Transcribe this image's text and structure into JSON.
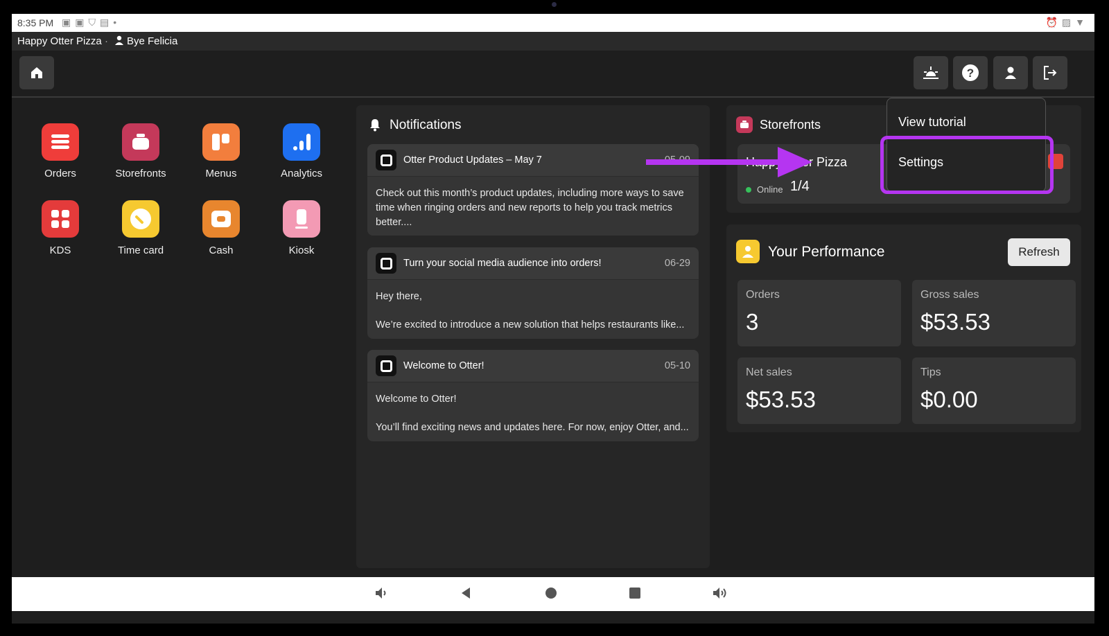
{
  "status": {
    "time": "8:35 PM"
  },
  "header": {
    "store_name": "Happy Otter Pizza",
    "separator": "·",
    "user_name": "Bye Felicia"
  },
  "apps": [
    {
      "label": "Orders",
      "color": "#ef3d3a"
    },
    {
      "label": "Storefronts",
      "color": "#c4395a"
    },
    {
      "label": "Menus",
      "color": "#f27e3d"
    },
    {
      "label": "Analytics",
      "color": "#1e6ff0"
    },
    {
      "label": "KDS",
      "color": "#e43b3b"
    },
    {
      "label": "Time card",
      "color": "#f6c930"
    },
    {
      "label": "Cash",
      "color": "#e8862e"
    },
    {
      "label": "Kiosk",
      "color": "#f39ab4"
    }
  ],
  "notifications": {
    "title": "Notifications",
    "items": [
      {
        "title": "Otter Product Updates – May 7",
        "date": "05-09",
        "body": "Check out this month’s product updates, including more ways to save time when ringing orders and new reports to help you track metrics better...."
      },
      {
        "title": "Turn your social media audience into orders!",
        "date": "06-29",
        "body1": "Hey there,",
        "body2": "We’re excited to introduce a new solution that helps restaurants like..."
      },
      {
        "title": "Welcome to Otter!",
        "date": "05-10",
        "body1": "Welcome to Otter!",
        "body2": "You’ll find exciting news and updates here. For now, enjoy Otter, and..."
      }
    ]
  },
  "storefronts": {
    "title": "Storefronts",
    "store_name": "Happy Otter Pizza",
    "status": "Online",
    "count": "1/4"
  },
  "performance": {
    "title": "Your Performance",
    "refresh_label": "Refresh",
    "stats": [
      {
        "label": "Orders",
        "value": "3"
      },
      {
        "label": "Gross sales",
        "value": "$53.53"
      },
      {
        "label": "Net sales",
        "value": "$53.53"
      },
      {
        "label": "Tips",
        "value": "$0.00"
      }
    ]
  },
  "menu": {
    "items": [
      "View tutorial",
      "Settings"
    ]
  },
  "colors": {
    "highlight": "#b535f1",
    "online": "#36c15b",
    "badge": "#e0433a"
  }
}
